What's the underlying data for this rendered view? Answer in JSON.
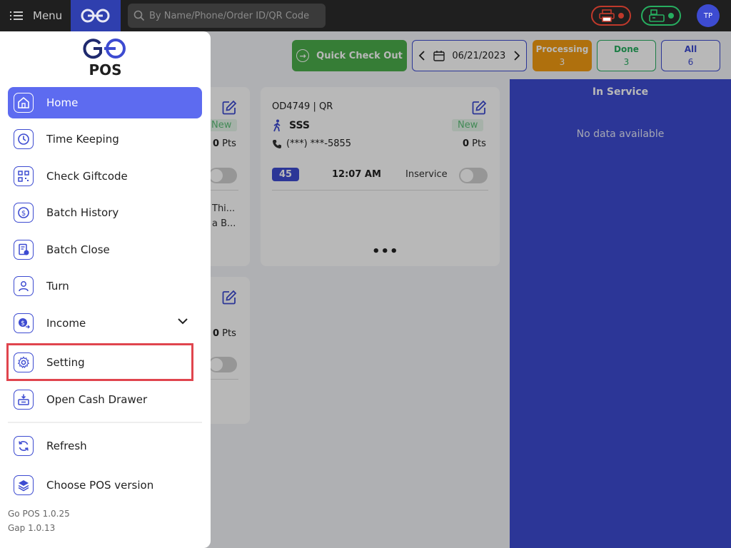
{
  "topbar": {
    "menu_label": "Menu",
    "search_placeholder": "By Name/Phone/Order ID/QR Code",
    "avatar_initials": "TP"
  },
  "toolbar": {
    "quick_checkout": "Quick Check Out",
    "date": "06/21/2023",
    "processing": {
      "label": "Processing",
      "count": "3"
    },
    "done": {
      "label": "Done",
      "count": "3"
    },
    "all": {
      "label": "All",
      "count": "6"
    }
  },
  "cards": {
    "card1": {
      "status": "New",
      "points_value": "0",
      "points_unit": " Pts",
      "notes_line1": "Thi...",
      "notes_line2": "a B..."
    },
    "card2": {
      "order_id": "OD4749 | QR",
      "customer": "SSS",
      "status": "New",
      "phone": "(***) ***-5855",
      "points_value": "0",
      "points_unit": " Pts",
      "duration": "45",
      "time": "12:07 AM",
      "inservice_label": "Inservice",
      "more": "•••"
    },
    "card3": {
      "points_value": "0",
      "points_unit": " Pts"
    }
  },
  "in_service": {
    "title": "In Service",
    "empty_text": "No data available"
  },
  "drawer": {
    "title": "POS",
    "items": [
      {
        "label": "Home",
        "icon": "home-icon"
      },
      {
        "label": "Time Keeping",
        "icon": "clock-icon"
      },
      {
        "label": "Check Giftcode",
        "icon": "qr-icon"
      },
      {
        "label": "Batch History",
        "icon": "dollar-coin-icon"
      },
      {
        "label": "Batch Close",
        "icon": "receipt-icon"
      },
      {
        "label": "Turn",
        "icon": "user-icon"
      },
      {
        "label": "Income",
        "icon": "income-icon"
      },
      {
        "label": "Setting",
        "icon": "gear-icon"
      },
      {
        "label": "Open Cash Drawer",
        "icon": "cash-drawer-icon"
      },
      {
        "label": "Refresh",
        "icon": "refresh-icon"
      },
      {
        "label": "Choose POS version",
        "icon": "layers-icon"
      }
    ],
    "version_app": "Go POS 1.0.25",
    "version_gap": "Gap 1.0.13"
  },
  "colors": {
    "accent": "#3d4bd1",
    "active_nav": "#5d6bf0",
    "highlight": "#e0454e",
    "success": "#4cae4c",
    "processing": "#f39c12"
  }
}
